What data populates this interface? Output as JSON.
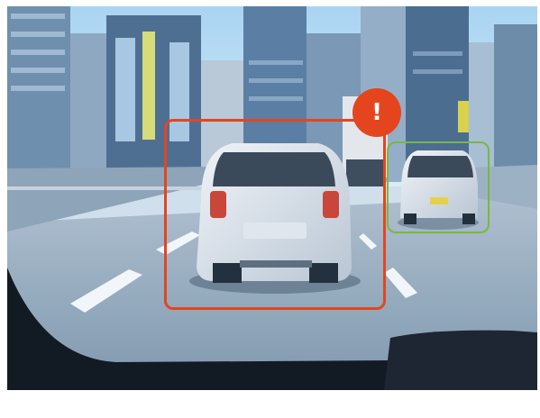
{
  "image": {
    "kind": "dashcam-road-scene",
    "objects": [
      {
        "label": "vehicle",
        "status": "warning",
        "color": "#e4451f"
      },
      {
        "label": "vehicle",
        "status": "normal",
        "color": "#7ab83c"
      }
    ]
  },
  "overlay": {
    "alert_badge": {
      "icon": "exclamation-icon",
      "glyph": "!",
      "color": "#e4451f"
    }
  }
}
